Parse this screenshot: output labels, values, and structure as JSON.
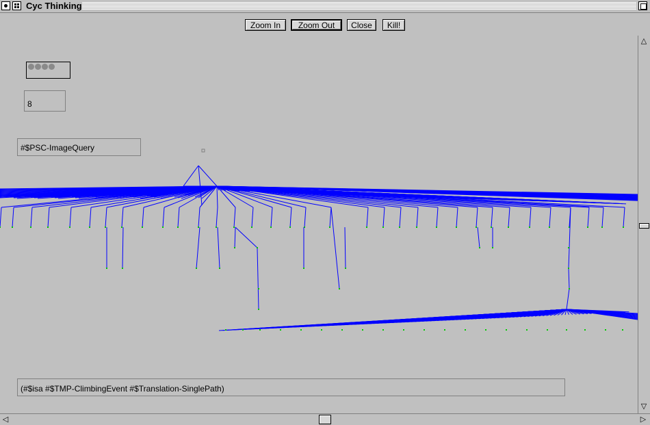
{
  "window": {
    "title": "Cyc Thinking"
  },
  "toolbar": {
    "zoom_in": "Zoom In",
    "zoom_out": "Zoom Out",
    "close": "Close",
    "kill": "Kill!"
  },
  "panel": {
    "counter": "8",
    "query": "#$PSC-ImageQuery",
    "assertion": "(#$isa #$TMP-ClimbingEvent #$Translation-SinglePath)"
  },
  "colors": {
    "edge": "#0000ff",
    "node": "#00cc00",
    "background": "#c0c0c0"
  }
}
